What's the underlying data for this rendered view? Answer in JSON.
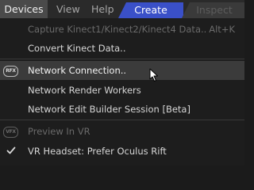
{
  "menubar": {
    "devices": "Devices",
    "view": "View",
    "help": "Help",
    "create_tab": "Create",
    "inspect_tab": "Inspect"
  },
  "dropdown": {
    "capture": {
      "label": "Capture Kinect1/Kinect2/Kinect4 Data..",
      "shortcut": "Alt+K",
      "enabled": false
    },
    "convert": {
      "label": "Convert Kinect Data..",
      "enabled": true
    },
    "network_connection": {
      "label": "Network Connection..",
      "icon": "rfx-icon",
      "icon_text": "RFX",
      "highlighted": true
    },
    "render_workers": {
      "label": "Network Render Workers"
    },
    "edit_builder": {
      "label": "Network Edit Builder Session [Beta]"
    },
    "preview_vr": {
      "label": "Preview In VR",
      "icon": "vfx-icon",
      "icon_text": "VFX",
      "enabled": false
    },
    "vr_headset": {
      "label": "VR Headset: Prefer Oculus Rift",
      "checked": true,
      "icon": "check-icon"
    }
  },
  "colors": {
    "create_tab": "#3a50c8",
    "inspect_tab": "#3a3a3a",
    "menu_background": "#1d1d1d",
    "highlight": "#3b3b3b"
  }
}
